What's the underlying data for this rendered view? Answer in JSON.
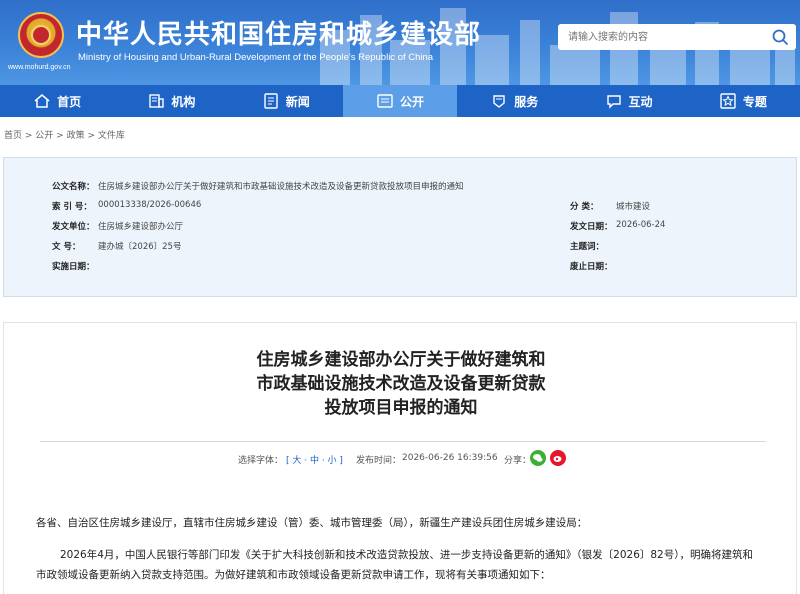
{
  "header": {
    "title": "中华人民共和国住房和城乡建设部",
    "subtitle": "Ministry of Housing and Urban-Rural Development of the People's Republic of China",
    "url": "www.mohurd.gov.cn",
    "search_placeholder": "请输入搜索的内容",
    "brand_color": "#2f6fc9"
  },
  "nav": {
    "items": [
      {
        "label": "首页",
        "icon": "home-icon"
      },
      {
        "label": "机构",
        "icon": "building-icon"
      },
      {
        "label": "新闻",
        "icon": "news-icon"
      },
      {
        "label": "公开",
        "icon": "document-icon",
        "active": true
      },
      {
        "label": "服务",
        "icon": "service-icon"
      },
      {
        "label": "互动",
        "icon": "chat-icon"
      },
      {
        "label": "专题",
        "icon": "star-icon"
      }
    ]
  },
  "breadcrumb": {
    "items": [
      "首页",
      "公开",
      "政策",
      "文件库"
    ],
    "separator": " > "
  },
  "meta": {
    "name_key": "公文名称：",
    "name_val": "住房城乡建设部办公厅关于做好建筑和市政基础设施技术改造及设备更新贷款投放项目申报的通知",
    "index_key": "索  引  号：",
    "index_val": "000013338/2026-00646",
    "category_key": "分      类：",
    "category_val": "城市建设",
    "issuer_key": "发文单位：",
    "issuer_val": "住房城乡建设部办公厅",
    "date_key": "发文日期：",
    "date_val": "2026-06-24",
    "docno_key": "文      号：",
    "docno_val": "建办城〔2026〕25号",
    "subject_key": "主题词：",
    "subject_val": "",
    "impl_key": "实施日期：",
    "impl_val": "",
    "expire_key": "废止日期：",
    "expire_val": ""
  },
  "article": {
    "title_line1": "住房城乡建设部办公厅关于做好建筑和",
    "title_line2": "市政基础设施技术改造及设备更新贷款",
    "title_line3": "投放项目申报的通知",
    "font_size_label": "选择字体：",
    "font_size_options": "[ 大 · 中 · 小 ]",
    "publish_label": "发布时间：",
    "publish_time": "2026-06-26 16:39:56",
    "share_label": "分享：",
    "para1": "各省、自治区住房城乡建设厅，直辖市住房城乡建设（管）委、城市管理委（局），新疆生产建设兵团住房城乡建设局：",
    "para2_line1": "2026年4月，中国人民银行等部门印发《关于扩大科技创新和技术改造贷款投放、进一步支持设备更新的通知》（银发〔2026〕82号），明确将建筑和",
    "para2_line2": "市政领域设备更新纳入贷款支持范围。为做好建筑和市政领域设备更新贷款申请工作，现将有关事项通知如下："
  }
}
